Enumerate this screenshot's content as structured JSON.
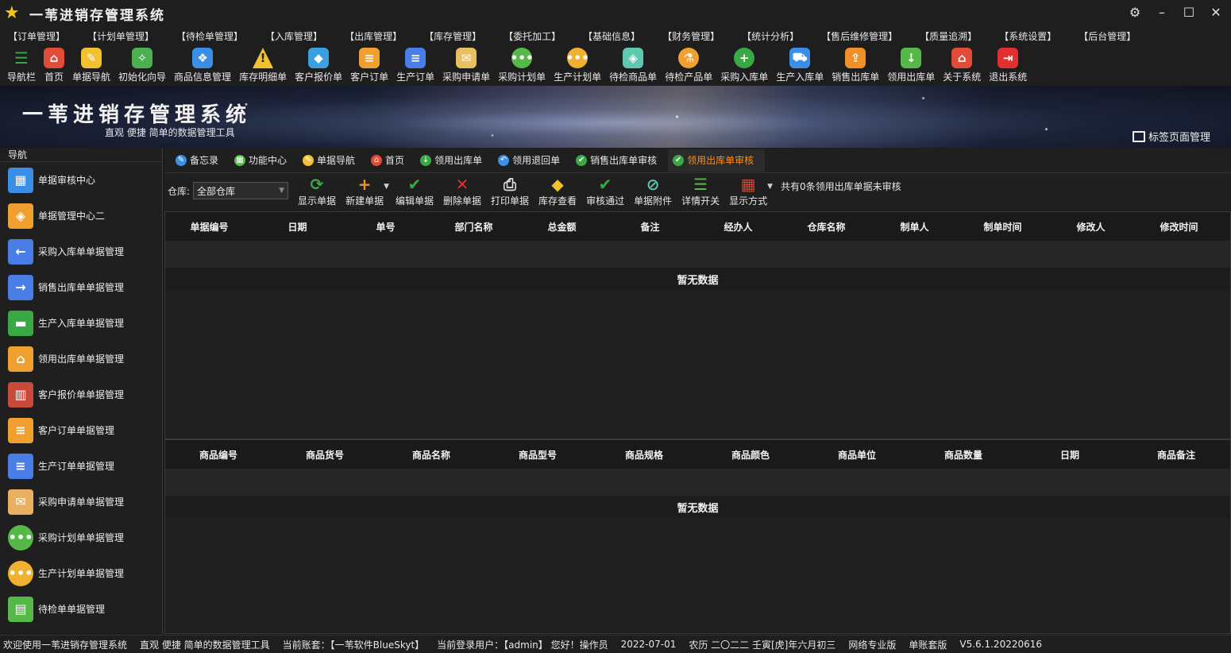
{
  "window": {
    "title": "一苇进销存管理系统",
    "buttons": [
      "settings-icon",
      "minimize-icon",
      "maximize-icon",
      "close-icon"
    ]
  },
  "menu": [
    "【订单管理】",
    "【计划单管理】",
    "【待检单管理】",
    "【入库管理】",
    "【出库管理】",
    "【库存管理】",
    "【委托加工】",
    "【基础信息】",
    "【财务管理】",
    "【统计分析】",
    "【售后维修管理】",
    "【质量追溯】",
    "【系统设置】",
    "【后台管理】"
  ],
  "toolbar": [
    {
      "label": "导航栏",
      "icon": "menu-icon",
      "color": "#3aa845"
    },
    {
      "label": "首页",
      "icon": "home-icon",
      "color": "#e04b3a"
    },
    {
      "label": "单据导航",
      "icon": "pen-icon",
      "color": "#f2c12e"
    },
    {
      "label": "初始化向导",
      "icon": "wand-icon",
      "color": "#4caf50"
    },
    {
      "label": "商品信息管理",
      "icon": "cubes-icon",
      "color": "#3a8ee6"
    },
    {
      "label": "库存明细单",
      "icon": "warning-icon",
      "color": "#f2c12e"
    },
    {
      "label": "客户报价单",
      "icon": "tag-icon",
      "color": "#3aa0e0"
    },
    {
      "label": "客户订单",
      "icon": "doc-icon",
      "color": "#f0a030"
    },
    {
      "label": "生产订单",
      "icon": "doc-icon",
      "color": "#4a7ee6"
    },
    {
      "label": "采购申请单",
      "icon": "envelope-icon",
      "color": "#e8c060"
    },
    {
      "label": "采购计划单",
      "icon": "chat-icon",
      "color": "#56b848"
    },
    {
      "label": "生产计划单",
      "icon": "chat-icon",
      "color": "#f0b030"
    },
    {
      "label": "待检商品单",
      "icon": "shield-icon",
      "color": "#5ec8b0"
    },
    {
      "label": "待检产品单",
      "icon": "flask-icon",
      "color": "#f0a030"
    },
    {
      "label": "采购入库单",
      "icon": "plus-icon",
      "color": "#3aa845"
    },
    {
      "label": "生产入库单",
      "icon": "cart-icon",
      "color": "#3a8ee6"
    },
    {
      "label": "销售出库单",
      "icon": "box-out-icon",
      "color": "#f0902a"
    },
    {
      "label": "领用出库单",
      "icon": "download-icon",
      "color": "#56b848"
    },
    {
      "label": "关于系统",
      "icon": "house-icon",
      "color": "#e04b3a"
    },
    {
      "label": "退出系统",
      "icon": "exit-icon",
      "color": "#e03030"
    }
  ],
  "banner": {
    "title": "一苇进销存管理系统",
    "subtitle": "直观 便捷 简单的数据管理工具",
    "tag_manager": "标签页面管理"
  },
  "sidebar": {
    "title": "导航",
    "items": [
      {
        "label": "单据审核中心",
        "color": "#3a8ee6",
        "glyph": "▦"
      },
      {
        "label": "单据管理中心二",
        "color": "#f0a030",
        "glyph": "◈"
      },
      {
        "label": "采购入库单单据管理",
        "color": "#4a7ee6",
        "glyph": "←"
      },
      {
        "label": "销售出库单单据管理",
        "color": "#4a7ee6",
        "glyph": "→"
      },
      {
        "label": "生产入库单单据管理",
        "color": "#3aa845",
        "glyph": "▬"
      },
      {
        "label": "领用出库单单据管理",
        "color": "#f0a030",
        "glyph": "⌂"
      },
      {
        "label": "客户报价单单据管理",
        "color": "#c84a3a",
        "glyph": "▥"
      },
      {
        "label": "客户订单单据管理",
        "color": "#f0a030",
        "glyph": "≡"
      },
      {
        "label": "生产订单单据管理",
        "color": "#4a7ee6",
        "glyph": "≡"
      },
      {
        "label": "采购申请单单据管理",
        "color": "#e8b060",
        "glyph": "✉"
      },
      {
        "label": "采购计划单单据管理",
        "color": "#56b848",
        "glyph": "•••"
      },
      {
        "label": "生产计划单单据管理",
        "color": "#f0b030",
        "glyph": "•••"
      },
      {
        "label": "待检单单据管理",
        "color": "#56b848",
        "glyph": "▤"
      }
    ]
  },
  "tabs": [
    {
      "label": "备忘录",
      "color": "#3a8ee6",
      "glyph": "✎",
      "active": false
    },
    {
      "label": "功能中心",
      "color": "#56b848",
      "glyph": "▦",
      "active": false
    },
    {
      "label": "单据导航",
      "color": "#f2c12e",
      "glyph": "✎",
      "active": false
    },
    {
      "label": "首页",
      "color": "#e04b3a",
      "glyph": "⌂",
      "active": false
    },
    {
      "label": "领用出库单",
      "color": "#3aa845",
      "glyph": "↓",
      "active": false
    },
    {
      "label": "领用退回单",
      "color": "#3a8ee6",
      "glyph": "↶",
      "active": false
    },
    {
      "label": "销售出库单审核",
      "color": "#3aa845",
      "glyph": "✔",
      "active": false
    },
    {
      "label": "领用出库单审核",
      "color": "#3aa845",
      "glyph": "✔",
      "active": true
    }
  ],
  "actions": {
    "warehouse_label": "仓库:",
    "warehouse_value": "全部仓库",
    "buttons": [
      {
        "label": "显示单据",
        "glyph": "⟳",
        "color": "#3aa845"
      },
      {
        "label": "新建单据",
        "glyph": "+",
        "color": "#f0902a",
        "dropdown": true
      },
      {
        "label": "编辑单据",
        "glyph": "✔",
        "color": "#3aa845"
      },
      {
        "label": "删除单据",
        "glyph": "✕",
        "color": "#e03030"
      },
      {
        "label": "打印单据",
        "glyph": "⎙",
        "color": "#dcdcdc"
      },
      {
        "label": "库存查看",
        "glyph": "◆",
        "color": "#f2c12e"
      },
      {
        "label": "审核通过",
        "glyph": "✔",
        "color": "#3aa845"
      },
      {
        "label": "单据附件",
        "glyph": "⊘",
        "color": "#5ec8b0"
      },
      {
        "label": "详情开关",
        "glyph": "☰",
        "color": "#56b848"
      },
      {
        "label": "显示方式",
        "glyph": "▦",
        "color": "#c84a3a",
        "dropdown": true
      }
    ],
    "info": "共有0条领用出库单据未审核"
  },
  "grid_top": {
    "columns": [
      "单据编号",
      "日期",
      "单号",
      "部门名称",
      "总金额",
      "备注",
      "经办人",
      "仓库名称",
      "制单人",
      "制单时间",
      "修改人",
      "修改时间"
    ],
    "empty_text": "暂无数据"
  },
  "grid_bottom": {
    "columns": [
      "商品编号",
      "商品货号",
      "商品名称",
      "商品型号",
      "商品规格",
      "商品颜色",
      "商品单位",
      "商品数量",
      "日期",
      "商品备注"
    ],
    "empty_text": "暂无数据"
  },
  "status": {
    "welcome": "欢迎使用一苇进销存管理系统",
    "slogan": "直观 便捷 简单的数据管理工具",
    "account": "当前账套：【一苇软件BlueSkyt】",
    "user": "当前登录用户：【admin】 您好！操作员",
    "date": "2022-07-01",
    "lunar": "农历 二〇二二 壬寅[虎]年六月初三",
    "edition": "网络专业版",
    "mode": "单账套版",
    "version": "V5.6.1.20220616"
  }
}
